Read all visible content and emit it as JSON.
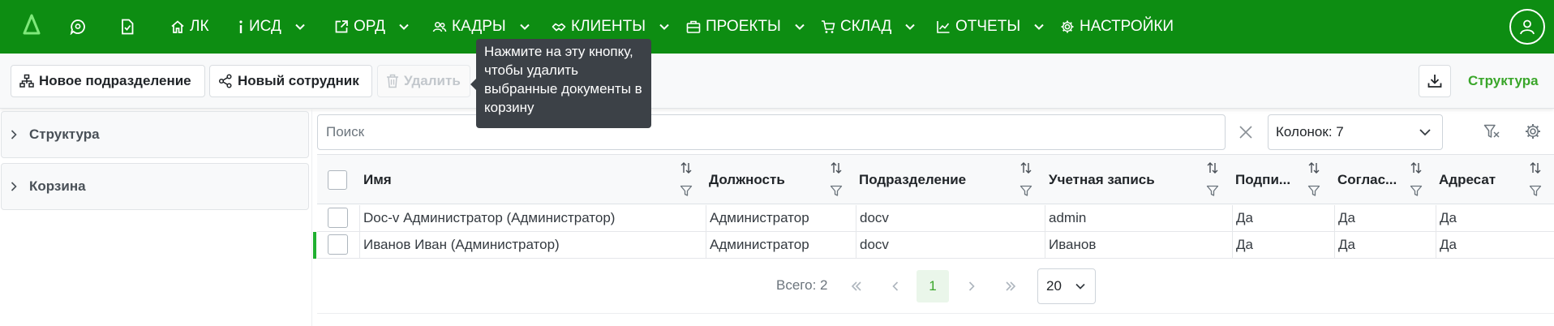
{
  "nav": {
    "items": [
      {
        "label": "ЛК",
        "icon": "home-icon",
        "dropdown": false
      },
      {
        "label": "ИСД",
        "icon": "info-icon",
        "dropdown": true
      },
      {
        "label": "ОРД",
        "icon": "external-link-icon",
        "dropdown": true
      },
      {
        "label": "КАДРЫ",
        "icon": "people-icon",
        "dropdown": true
      },
      {
        "label": "КЛИЕНТЫ",
        "icon": "handshake-icon",
        "dropdown": true
      },
      {
        "label": "ПРОЕКТЫ",
        "icon": "briefcase-icon",
        "dropdown": true
      },
      {
        "label": "СКЛАД",
        "icon": "cart-icon",
        "dropdown": true
      },
      {
        "label": "ОТЧЕТЫ",
        "icon": "chart-icon",
        "dropdown": true
      },
      {
        "label": "НАСТРОЙКИ",
        "icon": "gear-icon",
        "dropdown": false
      }
    ],
    "color": "#0d8d12"
  },
  "toolbar": {
    "new_department": "Новое подразделение",
    "new_employee": "Новый сотрудник",
    "delete": "Удалить",
    "structure_link": "Структура"
  },
  "tooltip": {
    "text": "Нажмите на эту кнопку, чтобы удалить выбранные документы в корзину"
  },
  "sidebar": {
    "panels": [
      {
        "label": "Структура"
      },
      {
        "label": "Корзина"
      }
    ]
  },
  "search": {
    "placeholder": "Поиск",
    "value": ""
  },
  "columns_select": {
    "value": "Колонок: 7"
  },
  "table": {
    "headers": [
      "Имя",
      "Должность",
      "Подразделение",
      "Учетная запись",
      "Подпи...",
      "Соглас...",
      "Адресат"
    ],
    "rows": [
      [
        "Doc-v Администратор (Администратор)",
        "Администратор",
        "docv",
        "admin",
        "Да",
        "Да",
        "Да"
      ],
      [
        "Иванов Иван (Администратор)",
        "Администратор",
        "docv",
        "Иванов",
        "Да",
        "Да",
        "Да"
      ]
    ]
  },
  "pagination": {
    "total": "Всего: 2",
    "current_page": "1",
    "page_size": "20"
  }
}
